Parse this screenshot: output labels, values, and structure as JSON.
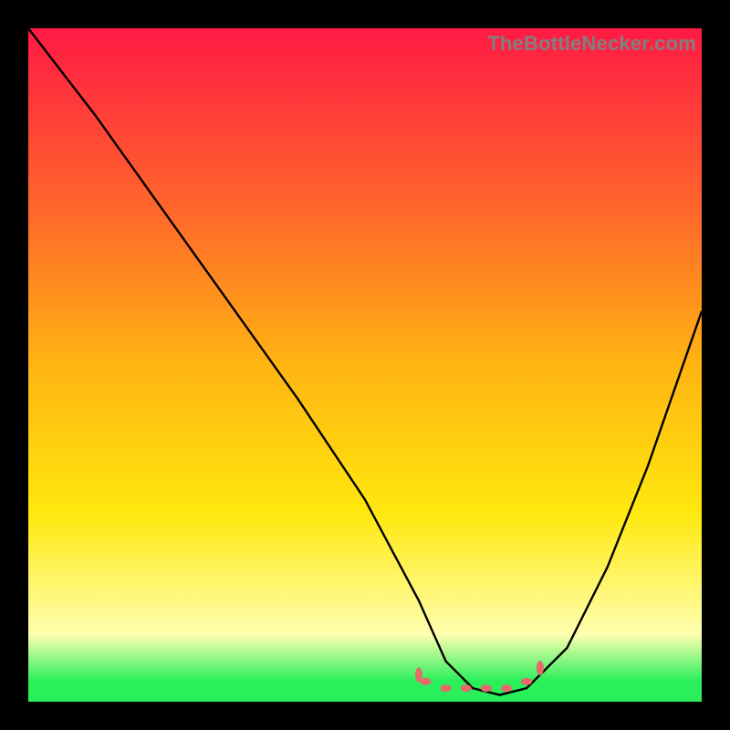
{
  "watermark": "TheBottleNecker.com",
  "colors": {
    "top": "#ff1a44",
    "upper_mid": "#ff6a2a",
    "mid": "#ffb412",
    "lower_mid": "#ffe80e",
    "pale": "#ffffb0",
    "green": "#28ef5a",
    "curve": "#000000",
    "marker": "#e66a6a"
  },
  "chart_data": {
    "type": "line",
    "title": "",
    "xlabel": "",
    "ylabel": "",
    "xlim": [
      0,
      100
    ],
    "ylim": [
      0,
      100
    ],
    "series": [
      {
        "name": "bottleneck-curve",
        "x": [
          0,
          10,
          20,
          30,
          40,
          50,
          58,
          62,
          66,
          70,
          74,
          80,
          86,
          92,
          100
        ],
        "values": [
          100,
          87,
          73,
          59,
          45,
          30,
          15,
          6,
          2,
          1,
          2,
          8,
          20,
          35,
          58
        ]
      }
    ],
    "markers": [
      {
        "name": "optimum-left-edge",
        "x": 58,
        "y": 4
      },
      {
        "name": "optimum-left-dot",
        "x": 59,
        "y": 3
      },
      {
        "name": "optimum-dot-1",
        "x": 62,
        "y": 2
      },
      {
        "name": "optimum-dot-2",
        "x": 65,
        "y": 2
      },
      {
        "name": "optimum-dot-3",
        "x": 68,
        "y": 2
      },
      {
        "name": "optimum-dot-4",
        "x": 71,
        "y": 2
      },
      {
        "name": "optimum-right-dot",
        "x": 74,
        "y": 3
      },
      {
        "name": "optimum-right-edge",
        "x": 76,
        "y": 5
      }
    ]
  }
}
